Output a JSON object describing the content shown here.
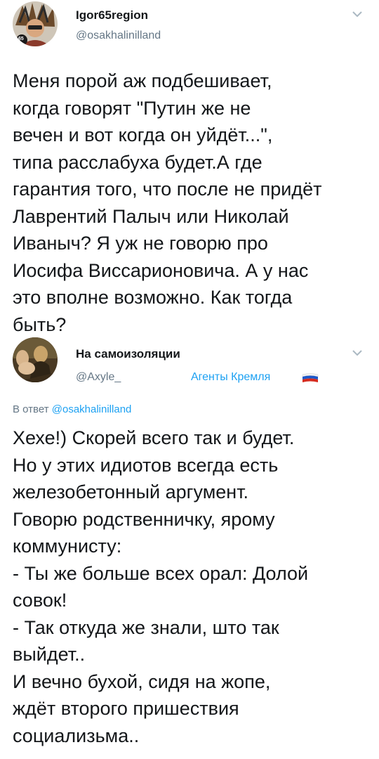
{
  "tweet1": {
    "name": "Igor65region",
    "handle": "@osakhalinilland",
    "text": "Меня порой аж подбешивает,\nкогда говорят \"Путин же не\nвечен и вот когда он уйдёт...\",\nтипа расслабуха будет.А где\nгарантия того, что после не придёт\nЛаврентий Палыч или Николай\nИваныч? Я уж не говорю про\nИосифа Виссарионовича. А у нас\nэто вполне возможно. Как тогда\nбыть?"
  },
  "tweet2": {
    "name": "На самоизоляции",
    "handle": "@Axyle_",
    "list_label": "Агенты Кремля",
    "reply_prefix": "В ответ",
    "reply_mention": "@osakhalinilland",
    "text": "Хехе!) Скорей всего так и будет.\nНо у этих идиотов всегда есть\nжелезобетонный аргумент.\nГоворю родственничку, ярому\nкоммунисту:\n- Ты же больше всех орал: Долой\nсовок!\n- Так откуда же знали, што так\nвыйдет..\nИ вечно бухой, сидя на жопе,\nждёт второго пришествия\nсоциализьма.."
  },
  "icons": {
    "chevron": "chevron-down-icon",
    "flag": "russia-flag-icon",
    "avatar_badge": "65"
  },
  "colors": {
    "link": "#1da1f2",
    "secondary": "#657786",
    "text": "#14171a"
  }
}
